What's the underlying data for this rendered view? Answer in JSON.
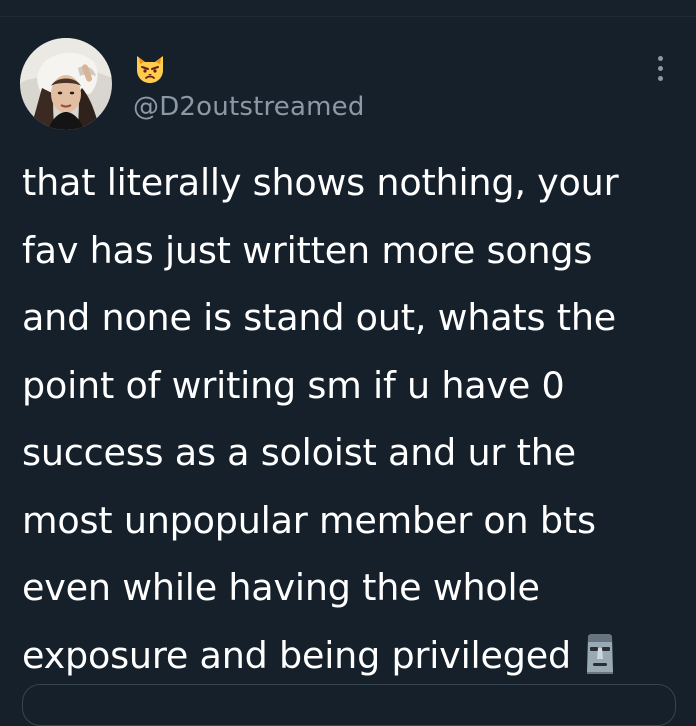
{
  "tweet": {
    "display_name_emoji": "pouting-cat-emoji",
    "handle": "@D2outstreamed",
    "text_lines": [
      "that literally shows nothing, your",
      "fav has just written more songs",
      "and none is stand out, whats the",
      "point of writing sm if u have 0",
      "success as a soloist and ur the",
      "most unpopular member on bts",
      "even while having the whole",
      "exposure and being privileged"
    ],
    "trailing_emoji": "moai-emoji"
  },
  "colors": {
    "background": "#15202b",
    "text": "#ffffff",
    "secondary_text": "#8b98a5"
  }
}
